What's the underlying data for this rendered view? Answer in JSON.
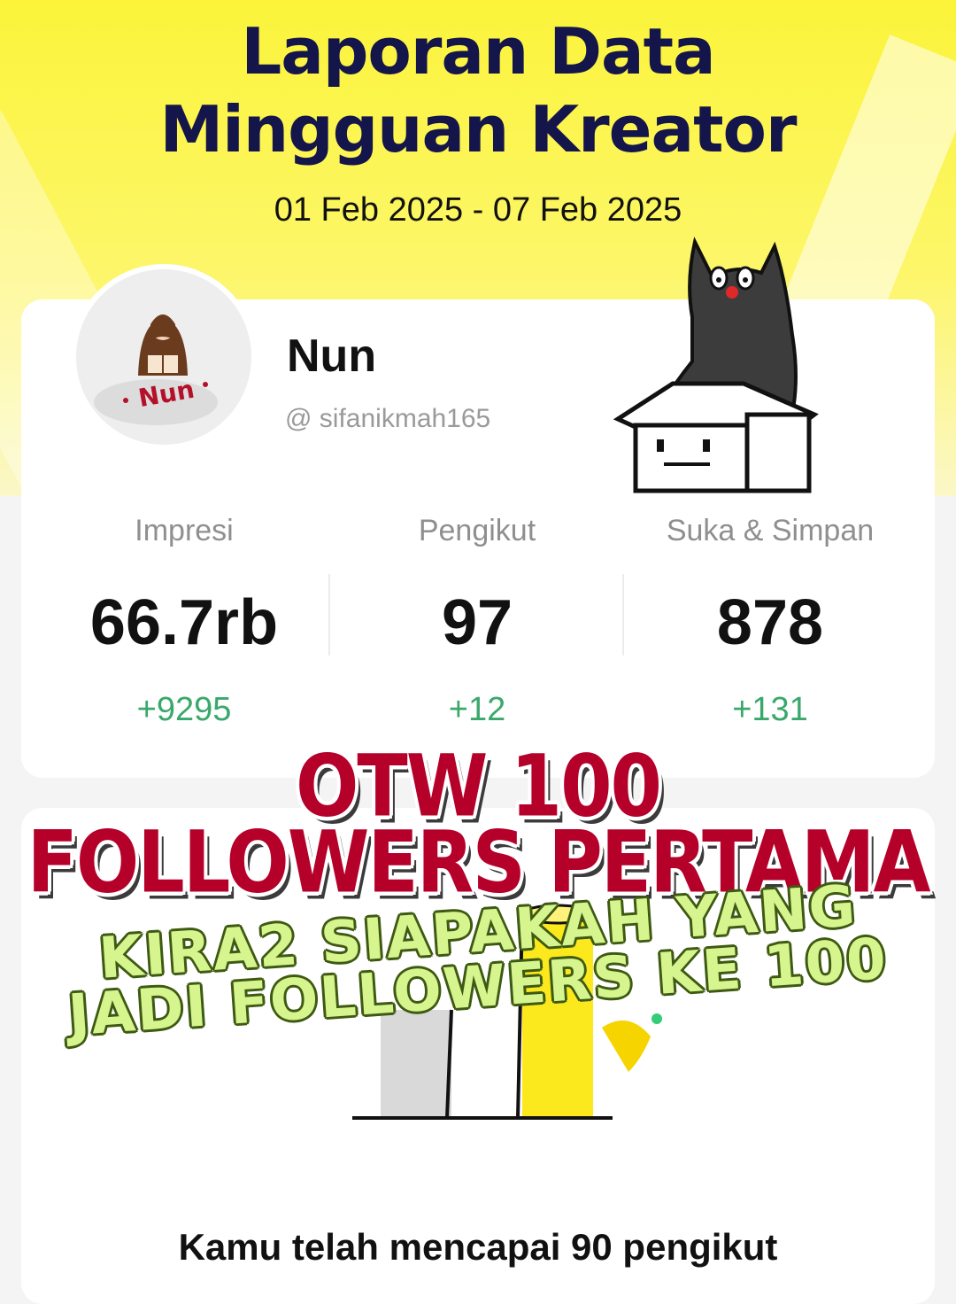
{
  "header": {
    "title_line1": "Laporan Data",
    "title_line2": "Mingguan Kreator",
    "date_range": "01 Feb 2025 - 07 Feb 2025"
  },
  "profile": {
    "name": "Nun",
    "handle": "@ sifanikmah165",
    "avatar_icon": "reading-girl-avatar-icon"
  },
  "stats": [
    {
      "label": "Impresi",
      "value": "66.7rb",
      "delta": "+9295"
    },
    {
      "label": "Pengikut",
      "value": "97",
      "delta": "+12"
    },
    {
      "label": "Suka & Simpan",
      "value": "878",
      "delta": "+131"
    }
  ],
  "overlay": {
    "line1": "OTW 100",
    "line2": "FOLLOWERS PERTAMA",
    "line3": "KIRA2 SIAPAKAH YANG",
    "line4": "JADI FOLLOWERS KE 100"
  },
  "milestone": {
    "text": "Kamu telah mencapai 90 pengikut"
  },
  "colors": {
    "hero_yellow": "#fbf43a",
    "title_navy": "#14154b",
    "delta_green": "#3aa86b",
    "overlay_red": "#b5002a",
    "overlay_lime": "#d6f58f"
  }
}
